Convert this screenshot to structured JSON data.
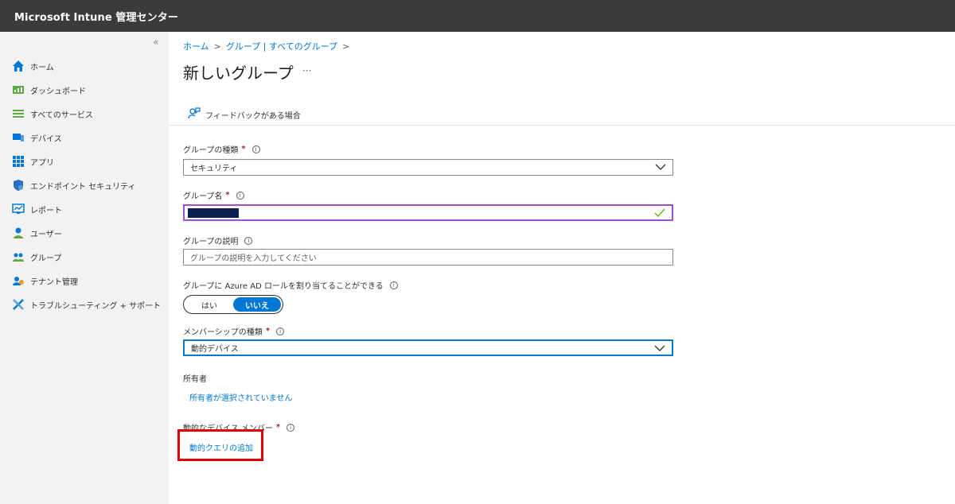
{
  "topbar": {
    "title": "Microsoft Intune 管理センター"
  },
  "sidebar": {
    "collapse_label": "«",
    "items": [
      {
        "label": "ホーム",
        "icon": "home-icon"
      },
      {
        "label": "ダッシュボード",
        "icon": "dashboard-icon"
      },
      {
        "label": "すべてのサービス",
        "icon": "list-icon"
      },
      {
        "label": "デバイス",
        "icon": "device-icon"
      },
      {
        "label": "アプリ",
        "icon": "apps-grid-icon"
      },
      {
        "label": "エンドポイント セキュリティ",
        "icon": "shield-icon"
      },
      {
        "label": "レポート",
        "icon": "report-icon"
      },
      {
        "label": "ユーザー",
        "icon": "user-icon"
      },
      {
        "label": "グループ",
        "icon": "group-icon"
      },
      {
        "label": "テナント管理",
        "icon": "tenant-icon"
      },
      {
        "label": "トラブルシューティング + サポート",
        "icon": "troubleshoot-icon"
      }
    ]
  },
  "breadcrumb": {
    "home": "ホーム",
    "sep": ">",
    "groups": "グループ | すべてのグループ",
    "sep2": ">"
  },
  "page": {
    "title": "新しいグループ",
    "more": "···"
  },
  "toolbar": {
    "feedback": "フィードバックがある場合"
  },
  "form": {
    "group_type": {
      "label": "グループの種類",
      "required": "*",
      "value": "セキュリティ"
    },
    "group_name": {
      "label": "グループ名",
      "required": "*",
      "value": ""
    },
    "group_desc": {
      "label": "グループの説明",
      "placeholder": "グループの説明を入力してください"
    },
    "azure_ad_role": {
      "label": "グループに Azure AD ロールを割り当てることができる",
      "yes": "はい",
      "no": "いいえ",
      "selected": "いいえ"
    },
    "membership_type": {
      "label": "メンバーシップの種類",
      "required": "*",
      "value": "動的デバイス"
    },
    "owner": {
      "label": "所有者",
      "link": "所有者が選択されていません"
    },
    "dynamic_members": {
      "label": "動的なデバイス メンバー",
      "required": "*",
      "link": "動的クエリの追加"
    }
  },
  "colors": {
    "accent": "#0078d4",
    "topbar": "#3b3b3b",
    "highlight": "#e00000",
    "required": "#a4262c"
  }
}
